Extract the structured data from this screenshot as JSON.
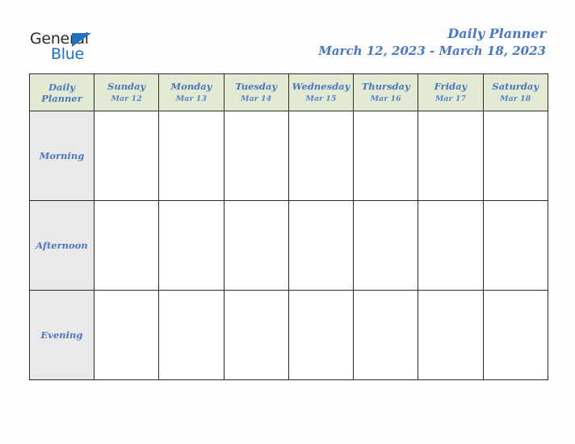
{
  "logo": {
    "word_one": "General",
    "word_two": "Blue",
    "triangle_icon": "triangle-icon",
    "triangle_color": "#1f6fc4",
    "word_one_color": "#2b2b2b",
    "word_two_color": "#1f6fc4"
  },
  "header": {
    "title": "Daily Planner",
    "date_range": "March 12, 2023 - March 18, 2023",
    "title_color": "#4a77bd"
  },
  "table": {
    "corner_label_line1": "Daily",
    "corner_label_line2": "Planner",
    "header_background": "#e2ead3",
    "label_background": "#e9e9e9",
    "cell_background": "#ffffff",
    "border_color": "#2a2a2a",
    "columns": [
      {
        "day": "Sunday",
        "date": "Mar 12"
      },
      {
        "day": "Monday",
        "date": "Mar 13"
      },
      {
        "day": "Tuesday",
        "date": "Mar 14"
      },
      {
        "day": "Wednesday",
        "date": "Mar 15"
      },
      {
        "day": "Thursday",
        "date": "Mar 16"
      },
      {
        "day": "Friday",
        "date": "Mar 17"
      },
      {
        "day": "Saturday",
        "date": "Mar 18"
      }
    ],
    "rows": [
      {
        "label": "Morning",
        "cells": [
          "",
          "",
          "",
          "",
          "",
          "",
          ""
        ]
      },
      {
        "label": "Afternoon",
        "cells": [
          "",
          "",
          "",
          "",
          "",
          "",
          ""
        ]
      },
      {
        "label": "Evening",
        "cells": [
          "",
          "",
          "",
          "",
          "",
          "",
          ""
        ]
      }
    ]
  }
}
